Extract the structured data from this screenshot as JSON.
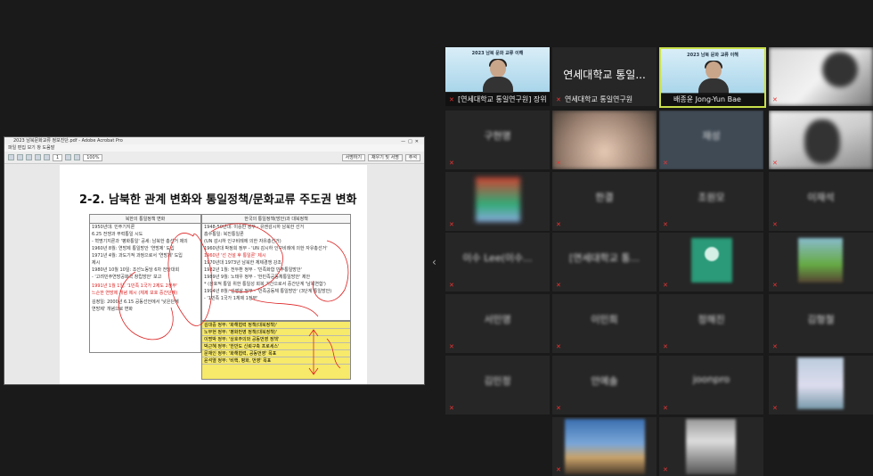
{
  "share": {
    "window_title": "2023 남북문화교류 정보진단.pdf - Adobe Acrobat Pro",
    "menu": "파일  편집  보기  창  도움말",
    "page_num": "1",
    "zoom": "100%",
    "tool_right_1": "서명하기",
    "tool_right_2": "채우기 및 서명",
    "tool_right_3": "주석",
    "doc_title": "2-2. 남북한 관계 변화와 통일정책/문화교류 주도권 변화",
    "left_head": "북한의 통일정책 변화",
    "left_rows": [
      {
        "t": "1950년대: 민주기지론",
        "red": false
      },
      {
        "t": "6.25 전쟁과 무력통일 시도",
        "red": false
      },
      {
        "t": "- 혁명기지론과 '평화통일' 공세: 남북한 총선거 제의",
        "red": false
      },
      {
        "t": "1960년 8월: 연방제 통일방안 '연방제' 도입",
        "red": false
      },
      {
        "t": "1971년 4월: 과도기적 과정으로서 '연방제' 도입",
        "red": false
      },
      {
        "t": "제시",
        "red": false
      },
      {
        "t": "1980년 10월 10일: 조선노동당 6차 전당대회",
        "red": false
      },
      {
        "t": "- '고려민주연방공화국 창립방안' 보고",
        "red": false
      },
      {
        "t": "",
        "red": false
      },
      {
        "t": "1991년 1월 1일: '1민족 1국가 2제도 2정부'",
        "red": true
      },
      {
        "t": "느슨한 연방제 개념 제시 (체제 보호 중간단계)",
        "red": true
      },
      {
        "t": "",
        "red": false
      },
      {
        "t": "김정일: 2000년 6.15 공동선언에서 '낮은단계",
        "red": false
      },
      {
        "t": "연방제' 개념으로 변화",
        "red": false
      }
    ],
    "right_head": "한국의 통일정책(방안)과 대북정책",
    "right_rows": [
      {
        "t": "1948-50년대: 이승만 정부 - 유엔감시하 남북한 선거",
        "red": false
      },
      {
        "t": "흡수통일: 북진통일론",
        "red": false
      },
      {
        "t": "(UN 감시하 인구비례에 의한 자유총선거)",
        "red": false
      },
      {
        "t": "1960년대 박정희 정부 - 'UN 감시하 인구비례에 의한 자유총선거'",
        "red": false
      },
      {
        "t": "1960년 '선 건설 후 통일론' 제시",
        "red": true
      },
      {
        "t": "1970년대 1973년 남북한 체제경쟁 강조",
        "red": false
      },
      {
        "t": "1982년 1월: 전두환 정부 - '민족화합 민주통일방안'",
        "red": false
      },
      {
        "t": "1989년 9월: 노태우 정부 - '한민족공동체통일방안' 제안",
        "red": false
      },
      {
        "t": "* (상호적 통일 위한 통일성 회복 기간으로서 중간단계 '남북연합')",
        "red": false
      },
      {
        "t": "1994년 8월: 김영삼 정부 - '민족공동체 통일방안' (3단계 통일방안)",
        "red": false
      },
      {
        "t": "- '1민족 1국가 1체제 1정부'",
        "red": false
      }
    ],
    "hl_rows": [
      "김대중 정부: '화해협력 정책(대북정책)'",
      "노무현 정부: '평화번영 정책(대북정책)'",
      "이명박 정부: '상호주의와 공동번영 정책'",
      "박근혜 정부: '한반도 신뢰구축 프로세스'",
      "문재인 정부: '화해협력, 공동번영' 목표",
      "윤석열 정부: '비핵, 평화, 번영' 목표"
    ]
  },
  "tiles": {
    "t1": {
      "name": "[연세대학교 통일연구원] 장위",
      "banner": "2023 남북 문화 교류 이해"
    },
    "t2": {
      "big": "연세대학교 통일...",
      "name": "연세대학교 통일연구원"
    },
    "t3": {
      "name": "배종윤 Jong-Yun Bae",
      "banner": "2023 남북 문화 교류 이해"
    },
    "t5": {
      "big": "구현명"
    },
    "t7": {
      "big": "재성"
    },
    "t10": {
      "big": "한결"
    },
    "t11": {
      "big": "조원모"
    },
    "t12": {
      "big": "이재석"
    },
    "t13": {
      "big": "이수 Lee(이수...",
      "name": "이수 Lee"
    },
    "t14": {
      "big": "[연세대학교 통...",
      "name": "[연세대학교 통일연구원]"
    },
    "t17": {
      "big": "서민영"
    },
    "t18": {
      "big": "이민희"
    },
    "t19": {
      "big": "정해진"
    },
    "t20": {
      "big": "김형철"
    },
    "t21": {
      "big": "김민정"
    },
    "t22": {
      "big": "안예솔"
    },
    "t23": {
      "big": "joonpro"
    }
  },
  "colors": {
    "active_border": "#c9e04a",
    "mic_muted": "#e33333",
    "pen_red": "#d22222"
  }
}
